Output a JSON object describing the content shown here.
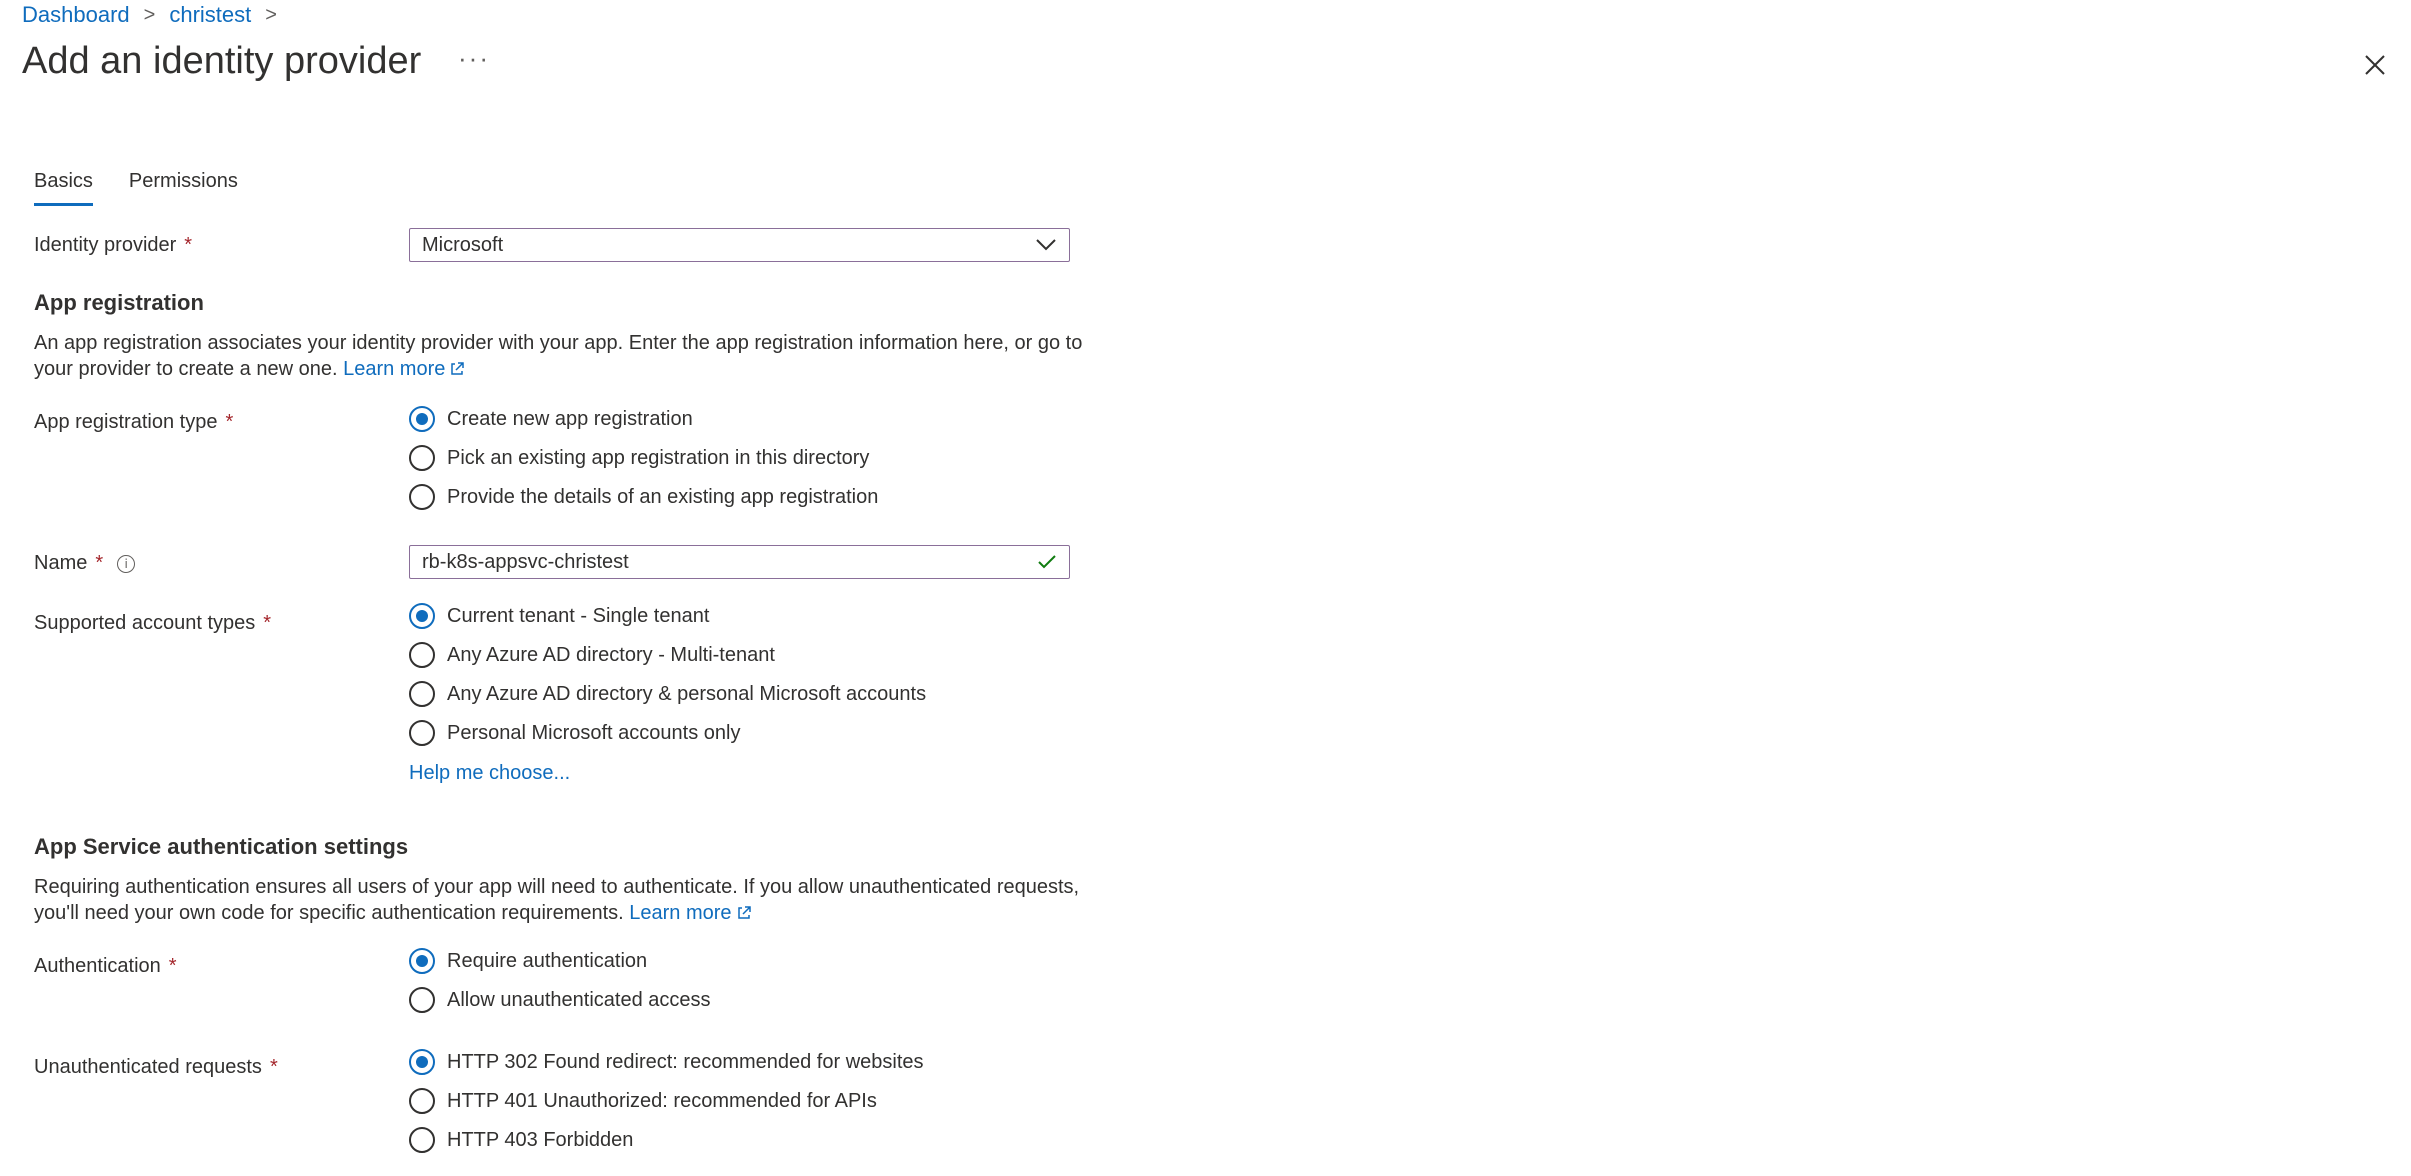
{
  "breadcrumb": {
    "items": [
      "Dashboard",
      "christest"
    ]
  },
  "page": {
    "title": "Add an identity provider",
    "more": "···"
  },
  "tabs": [
    "Basics",
    "Permissions"
  ],
  "identity_provider": {
    "label": "Identity provider",
    "value": "Microsoft"
  },
  "app_registration": {
    "heading": "App registration",
    "description": "An app registration associates your identity provider with your app. Enter the app registration information here, or go to your provider to create a new one.",
    "learn_more": "Learn more",
    "type_label": "App registration type",
    "options": [
      "Create new app registration",
      "Pick an existing app registration in this directory",
      "Provide the details of an existing app registration"
    ],
    "selected_index": 0
  },
  "name": {
    "label": "Name",
    "value": "rb-k8s-appsvc-christest"
  },
  "account_types": {
    "label": "Supported account types",
    "options": [
      "Current tenant - Single tenant",
      "Any Azure AD directory - Multi-tenant",
      "Any Azure AD directory & personal Microsoft accounts",
      "Personal Microsoft accounts only"
    ],
    "selected_index": 0,
    "help_link": "Help me choose..."
  },
  "auth_settings": {
    "heading": "App Service authentication settings",
    "description": "Requiring authentication ensures all users of your app will need to authenticate. If you allow unauthenticated requests, you'll need your own code for specific authentication requirements.",
    "learn_more": "Learn more",
    "authentication": {
      "label": "Authentication",
      "options": [
        "Require authentication",
        "Allow unauthenticated access"
      ],
      "selected_index": 0
    },
    "unauthenticated": {
      "label": "Unauthenticated requests",
      "options": [
        "HTTP 302 Found redirect: recommended for websites",
        "HTTP 401 Unauthorized: recommended for APIs",
        "HTTP 403 Forbidden"
      ],
      "selected_index": 0
    }
  },
  "required_marker": "*",
  "colors": {
    "accent": "#0f6cbd",
    "required": "#a4262c",
    "valid": "#107c10"
  }
}
